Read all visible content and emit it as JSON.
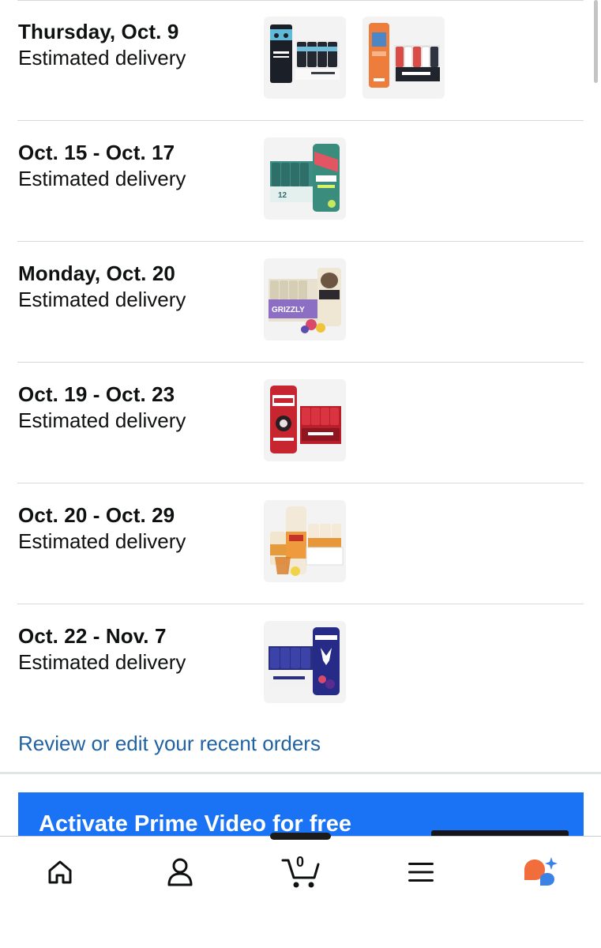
{
  "deliveries": [
    {
      "date": "Thursday, Oct. 9",
      "label": "Estimated delivery",
      "thumbs": [
        "black-rifle-energy-can-pack-icon",
        "orange-energy-can-bundle-icon"
      ]
    },
    {
      "date": "Oct. 15 - Oct. 17",
      "label": "Estimated delivery",
      "thumbs": [
        "gorilla-energy-can-pack-icon"
      ]
    },
    {
      "date": "Monday, Oct. 20",
      "label": "Estimated delivery",
      "thumbs": [
        "grizzly-energy-can-pack-icon"
      ]
    },
    {
      "date": "Oct. 19 - Oct. 23",
      "label": "Estimated delivery",
      "thumbs": [
        "weird-tea-can-pack-icon"
      ]
    },
    {
      "date": "Oct. 20 - Oct. 29",
      "label": "Estimated delivery",
      "thumbs": [
        "bum-energy-can-pack-icon"
      ]
    },
    {
      "date": "Oct. 22 - Nov. 7",
      "label": "Estimated delivery",
      "thumbs": [
        "bucked-up-protein-can-pack-icon"
      ]
    }
  ],
  "review_link": "Review or edit your recent orders",
  "prime_banner": {
    "text": "Activate Prime Video for free",
    "color": "#1a73f5"
  },
  "nav": {
    "cart_count": "0",
    "items": [
      "home-icon",
      "account-icon",
      "cart-icon",
      "menu-icon",
      "rufus-assistant-icon"
    ]
  },
  "colors": {
    "link": "#2162a1",
    "text": "#0f1111",
    "divider": "#d5d9d9",
    "assistant_orange": "#f26d3c",
    "assistant_blue": "#3b82e6"
  }
}
